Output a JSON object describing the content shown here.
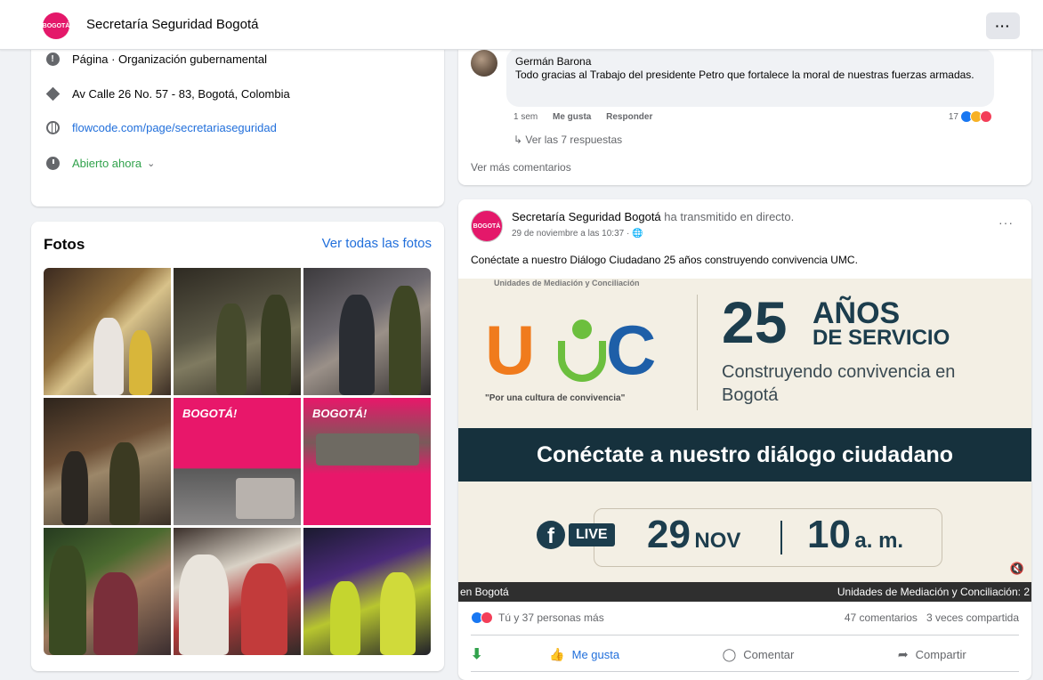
{
  "header": {
    "page_name": "Secretaría Seguridad Bogotá",
    "more_label": "···",
    "avatar_text": "BOGOTÁ"
  },
  "intro": {
    "category": "Página · Organización gubernamental",
    "address": "Av Calle 26 No. 57 - 83, Bogotá, Colombia",
    "website": "flowcode.com/page/secretariaseguridad",
    "hours": "Abierto ahora",
    "hours_chevron": "⌄"
  },
  "photos": {
    "title": "Fotos",
    "see_all": "Ver todas las fotos",
    "tile_captions": [
      "BOGOTÁ!",
      "BOGOTÁ!"
    ]
  },
  "comment": {
    "author": "Germán Barona",
    "text": "Todo gracias al Trabajo del presidente Petro que fortalece la moral de nuestras fuerzas armadas.",
    "time": "1 sem",
    "like_label": "Me gusta",
    "reply_label": "Responder",
    "reaction_count": "17",
    "view_replies": "↳ Ver las 7 respuestas",
    "view_more": "Ver más comentarios"
  },
  "post": {
    "author": "Secretaría Seguridad Bogotá",
    "action": "ha transmitido en directo.",
    "timestamp": "29 de noviembre a las 10:37 · 🌐",
    "avatar_text": "BOGOTÁ",
    "more_label": "···",
    "text": "Conéctate a nuestro Diálogo Ciudadano 25 años construyendo convivencia UMC.",
    "video": {
      "top_line": "Unidades de Mediación y Conciliación",
      "logo_u": "U",
      "logo_c": "C",
      "slogan": "\"Por una cultura de convivencia\"",
      "big_number": "25",
      "anos": "AÑOS",
      "servicio": "DE SERVICIO",
      "construyendo": "Construyendo convivencia en Bogotá",
      "banner": "Conéctate a nuestro diálogo ciudadano",
      "live_f": "f",
      "live_label": "LIVE",
      "date_num": "29",
      "date_month": "NOV",
      "time_num": "10",
      "time_unit": "a. m.",
      "ticker_left": "en Bogotá",
      "ticker_right": "Unidades de Mediación y Conciliación: 2",
      "volume_icon": "🔇"
    },
    "reactions_text": "Tú y 37 personas más",
    "comments_count": "47 comentarios",
    "shares_count": "3 veces compartida",
    "like_action": "Me gusta",
    "comment_action": "Comentar",
    "share_action": "Compartir"
  }
}
